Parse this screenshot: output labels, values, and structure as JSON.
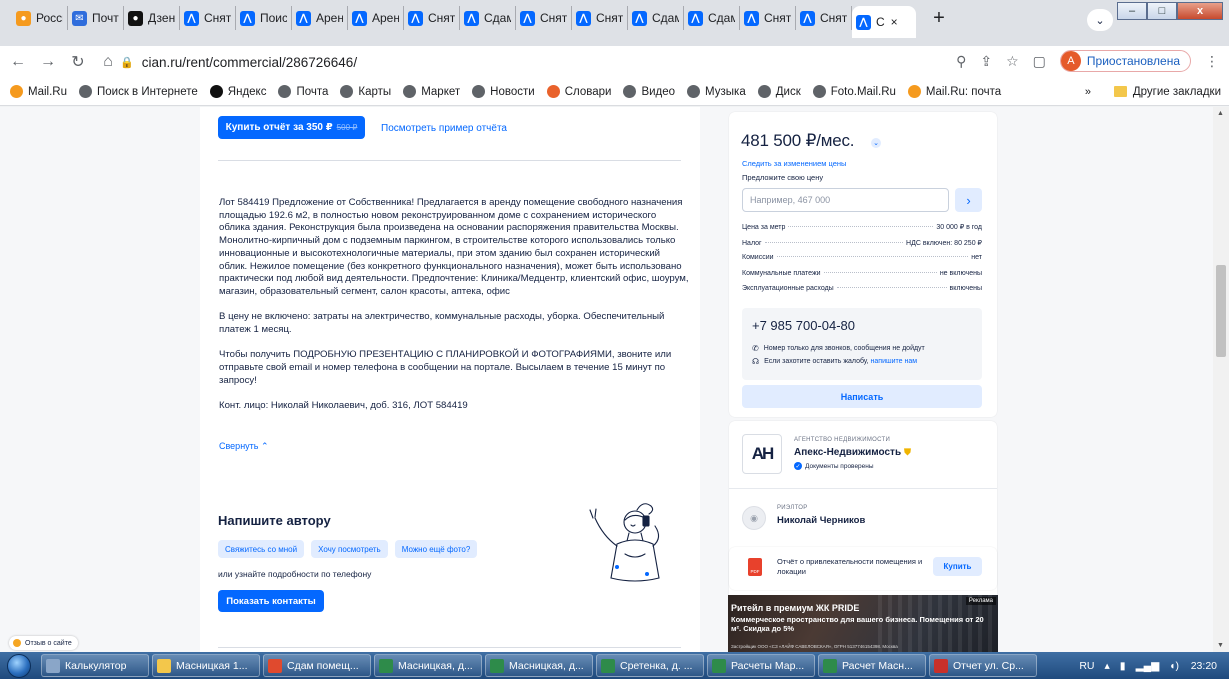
{
  "browser": {
    "tabs": [
      {
        "title": "Росси",
        "icon": "mailru-icon",
        "color": "#f59a1e"
      },
      {
        "title": "Почта",
        "icon": "mail-icon",
        "color": "#2f6ddc"
      },
      {
        "title": "Дзен",
        "icon": "dzen-icon",
        "color": "#111111"
      },
      {
        "title": "Снять",
        "icon": "cian-icon",
        "color": "#0468ff"
      },
      {
        "title": "Поиск",
        "icon": "cian-icon",
        "color": "#0468ff"
      },
      {
        "title": "Аренд",
        "icon": "cian-icon",
        "color": "#0468ff"
      },
      {
        "title": "Аренд",
        "icon": "cian-icon",
        "color": "#0468ff"
      },
      {
        "title": "Снять",
        "icon": "cian-icon",
        "color": "#0468ff"
      },
      {
        "title": "Сдам",
        "icon": "cian-icon",
        "color": "#0468ff"
      },
      {
        "title": "Снять",
        "icon": "cian-icon",
        "color": "#0468ff"
      },
      {
        "title": "Снять",
        "icon": "cian-icon",
        "color": "#0468ff"
      },
      {
        "title": "Сдам",
        "icon": "cian-icon",
        "color": "#0468ff"
      },
      {
        "title": "Сдам",
        "icon": "cian-icon",
        "color": "#0468ff"
      },
      {
        "title": "Снять",
        "icon": "cian-icon",
        "color": "#0468ff"
      },
      {
        "title": "Снять",
        "icon": "cian-icon",
        "color": "#0468ff"
      }
    ],
    "active_tab": {
      "title": "С",
      "icon": "cian-icon",
      "close": "×"
    },
    "new_tab": "+",
    "url": "cian.ru/rent/commercial/286726646/",
    "profile_initial": "A",
    "profile_status": "Приостановлена",
    "bookmarks": [
      {
        "label": "Mail.Ru",
        "color": "#f59a1e"
      },
      {
        "label": "Поиск в Интернете",
        "color": "#5f6368"
      },
      {
        "label": "Яндекс",
        "color": "#111111"
      },
      {
        "label": "Почта",
        "color": "#5f6368"
      },
      {
        "label": "Карты",
        "color": "#5f6368"
      },
      {
        "label": "Маркет",
        "color": "#5f6368"
      },
      {
        "label": "Новости",
        "color": "#5f6368"
      },
      {
        "label": "Словари",
        "color": "#e9622b"
      },
      {
        "label": "Видео",
        "color": "#5f6368"
      },
      {
        "label": "Музыка",
        "color": "#5f6368"
      },
      {
        "label": "Диск",
        "color": "#5f6368"
      },
      {
        "label": "Foto.Mail.Ru",
        "color": "#5f6368"
      },
      {
        "label": "Mail.Ru: почта",
        "color": "#f59a1e"
      }
    ],
    "bookmarks_more": "»",
    "other_bookmarks": "Другие закладки"
  },
  "page": {
    "report_button": "Купить отчёт за 350 ₽",
    "report_old_price": "500 ₽",
    "sample_link": "Посмотреть пример отчёта",
    "description": [
      "Лот 584419 Предложение от Собственника! Предлагается в аренду помещение свободного назначения площадью 192.6 м2, в полностью новом реконструированном доме с сохранением исторического облика здания. Реконструкция была произведена на основании распоряжения правительства Москвы. Монолитно-кирпичный дом с подземным паркингом, в строительстве которого использовались только инновационные и высокотехнологичные материалы, при этом зданию был сохранен исторический облик. Нежилое помещение (без конкретного функционального назначения), может быть использовано практически под любой вид деятельности. Предпочтение:   Клиника/Медцентр, клиентский офис, шоурум, магазин, образовательный сегмент, салон красоты, аптека, офис",
      " В цену не включено: затраты на электричество, коммунальные расходы, уборка. Обеспечительный платеж 1 месяц.",
      "Чтобы получить ПОДРОБНУЮ ПРЕЗЕНТАЦИЮ С ПЛАНИРОВКОЙ И ФОТОГРАФИЯМИ, звоните или отправьте свой email и номер телефона в сообщении на портале. Высылаем в течение 15 минут по запросу!",
      " Конт. лицо: Николай Николаевич, доб. 316, ЛОТ 584419"
    ],
    "collapse": "Свернуть",
    "write_author_title": "Напишите автору",
    "chips": [
      "Свяжитесь со мной",
      "Хочу посмотреть",
      "Можно ещё фото?"
    ],
    "phone_hint": "или узнайте подробности по телефону",
    "show_contacts": "Показать контакты",
    "feedback": "Отзыв о сайте"
  },
  "sidebar": {
    "price": "481 500 ₽/мес.",
    "follow_price": "Следить за изменением цены",
    "offer_label": "Предложите свою цену",
    "offer_placeholder": "Например, 467 000",
    "params": [
      {
        "label": "Цена за метр",
        "value": "30 000 ₽ в год"
      },
      {
        "label": "Налог",
        "value": "НДС включен: 80 250 ₽"
      },
      {
        "label": "Комиссии",
        "value": "нет"
      },
      {
        "label": "Коммунальные платежи",
        "value": "не включены"
      },
      {
        "label": "Эксплуатационные расходы",
        "value": "включены"
      }
    ],
    "phone": "+7 985 700-04-80",
    "phone_note": "Номер только для звонков, сообщения не дойдут",
    "complaint_text": "Если захотите оставить жалобу,",
    "complaint_link": "напишите нам",
    "write_button": "Написать",
    "agency_logo": "АН",
    "agency_kind": "АГЕНТСТВО НЕДВИЖИМОСТИ",
    "agency_name": "Апекс-Недвижимость",
    "docs_checked": "Документы проверены",
    "realtor_kind": "РИЭЛТОР",
    "realtor_name": "Николай Черников",
    "report_pdf": "PDF",
    "report_text": "Отчёт о привлекательности помещения и локации",
    "buy_button": "Купить",
    "ad": {
      "badge": "Реклама",
      "title": "Ритейл в премиум ЖК PRIDE",
      "text": "Коммерческое пространство для вашего бизнеса. Помещения от 20 м². Скидка до 5%",
      "legal": "Застройщик ООО «СЗ «ЛАЙФ САВЕЛОВСКАЯ», ОГРН 5137746154398. Москва"
    }
  },
  "taskbar": {
    "items": [
      {
        "label": "Калькулятор",
        "color": "#8aa6c8"
      },
      {
        "label": "Масницкая 1...",
        "color": "#f3c74b"
      },
      {
        "label": "Сдам помещ...",
        "color": "#e04a2e"
      },
      {
        "label": "Масницкая, д...",
        "color": "#2e8b4a"
      },
      {
        "label": "Масницкая, д...",
        "color": "#2e8b4a"
      },
      {
        "label": "Сретенка, д. ...",
        "color": "#2e8b4a"
      },
      {
        "label": "Расчеты Мар...",
        "color": "#2e8b4a"
      },
      {
        "label": "Расчет Масн...",
        "color": "#2e8b4a"
      },
      {
        "label": "Отчет ул. Ср...",
        "color": "#c8302a"
      }
    ],
    "lang": "RU",
    "time": "23:20"
  }
}
